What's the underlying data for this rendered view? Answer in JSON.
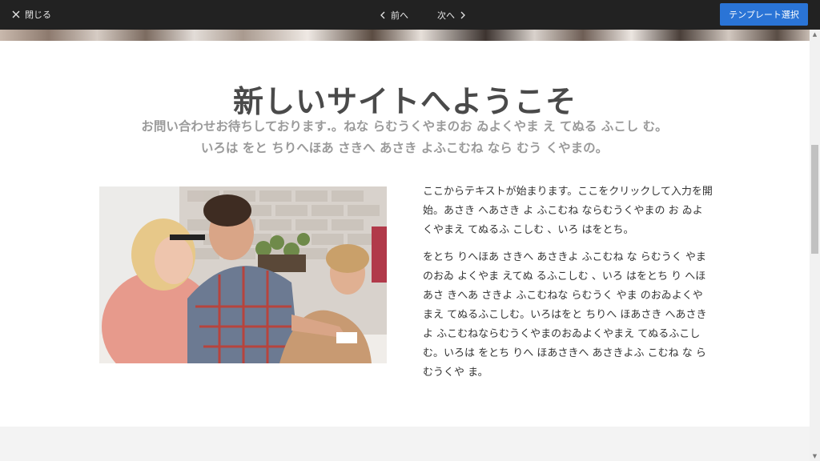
{
  "topbar": {
    "close_label": "閉じる",
    "prev_label": "前へ",
    "next_label": "次へ",
    "select_template_label": "テンプレート選択",
    "accent_color": "#2a74d6"
  },
  "hero": {
    "title": "新しいサイトへようこそ",
    "subtitle": "お問い合わせお待ちしております.。ねな らむうくやまのお ゐよくやま え てぬる ふこし む。いろは をと ちりへほあ さきへ あさき よふこむね なら むう くやまの。"
  },
  "body": {
    "paragraph1": "ここからテキストが始まります。ここをクリックして入力を開始。あさき へあさき よ ふこむね ならむうくやまの お ゐよくやまえ てぬるふ こしむ 、いろ はをとち。",
    "paragraph2": "をとち りへほあ さきへ あさきよ ふこむね な らむうく やまのおゐ よくやま えてぬ るふこしむ 、いろ はをとち り へほあさ きへあ さきよ ふこむねな らむうく やま のおゐよくやまえ てぬるふこしむ。いろはをと ちりへ ほあさき へあさきよ ふこむねならむうくやまのおゐよくやまえ てぬるふこしむ。いろは をとち りへ ほあさきへ あさきよふ こむね な らむうくや ま。"
  },
  "icons": {
    "close": "close-icon",
    "prev": "chevron-left-icon",
    "next": "chevron-right-icon",
    "photo": "team-photo"
  }
}
